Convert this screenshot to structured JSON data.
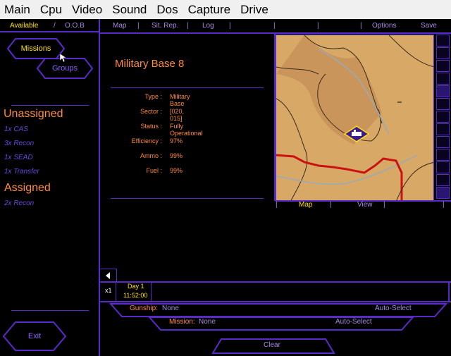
{
  "menubar": [
    "Main",
    "Cpu",
    "Video",
    "Sound",
    "Dos",
    "Capture",
    "Drive"
  ],
  "top_tabs": {
    "available": "Available",
    "oob": "O.O.B",
    "map": "Map",
    "sit_rep": "Sit. Rep.",
    "log": "Log",
    "options": "Options",
    "save": "Save"
  },
  "left": {
    "missions_btn": "Missions",
    "groups_btn": "Groups",
    "unassigned_title": "Unassigned",
    "unassigned": [
      "1x CAS",
      "3x Recon",
      "1x SEAD",
      "1x Transfer"
    ],
    "assigned_title": "Assigned",
    "assigned": [
      "2x Recon"
    ],
    "exit_btn": "Exit"
  },
  "base": {
    "title": "Military Base 8",
    "rows": [
      {
        "label": "Type :",
        "value": "Military Base"
      },
      {
        "label": "Sector :",
        "value": "[020, 015]"
      },
      {
        "label": "Status :",
        "value": "Fully Operational"
      },
      {
        "label": "Efficiency :",
        "value": "97%"
      },
      {
        "label": "Ammo :",
        "value": "99%"
      },
      {
        "label": "Fuel :",
        "value": "99%"
      }
    ]
  },
  "map_tabs": {
    "map": "Map",
    "view": "View"
  },
  "time": {
    "speed": "x1",
    "day": "Day 1",
    "clock": "11:52:00"
  },
  "gunship": {
    "label": "Gunship:",
    "value": "None",
    "auto": "Auto-Select"
  },
  "mission": {
    "label": "Mission:",
    "value": "None",
    "auto": "Auto-Select"
  },
  "clear": "Clear",
  "colors": {
    "accent": "#5a2ac8",
    "orange": "#ff8a3a",
    "yellow": "#ffe000",
    "map_bg": "#d7a866"
  }
}
